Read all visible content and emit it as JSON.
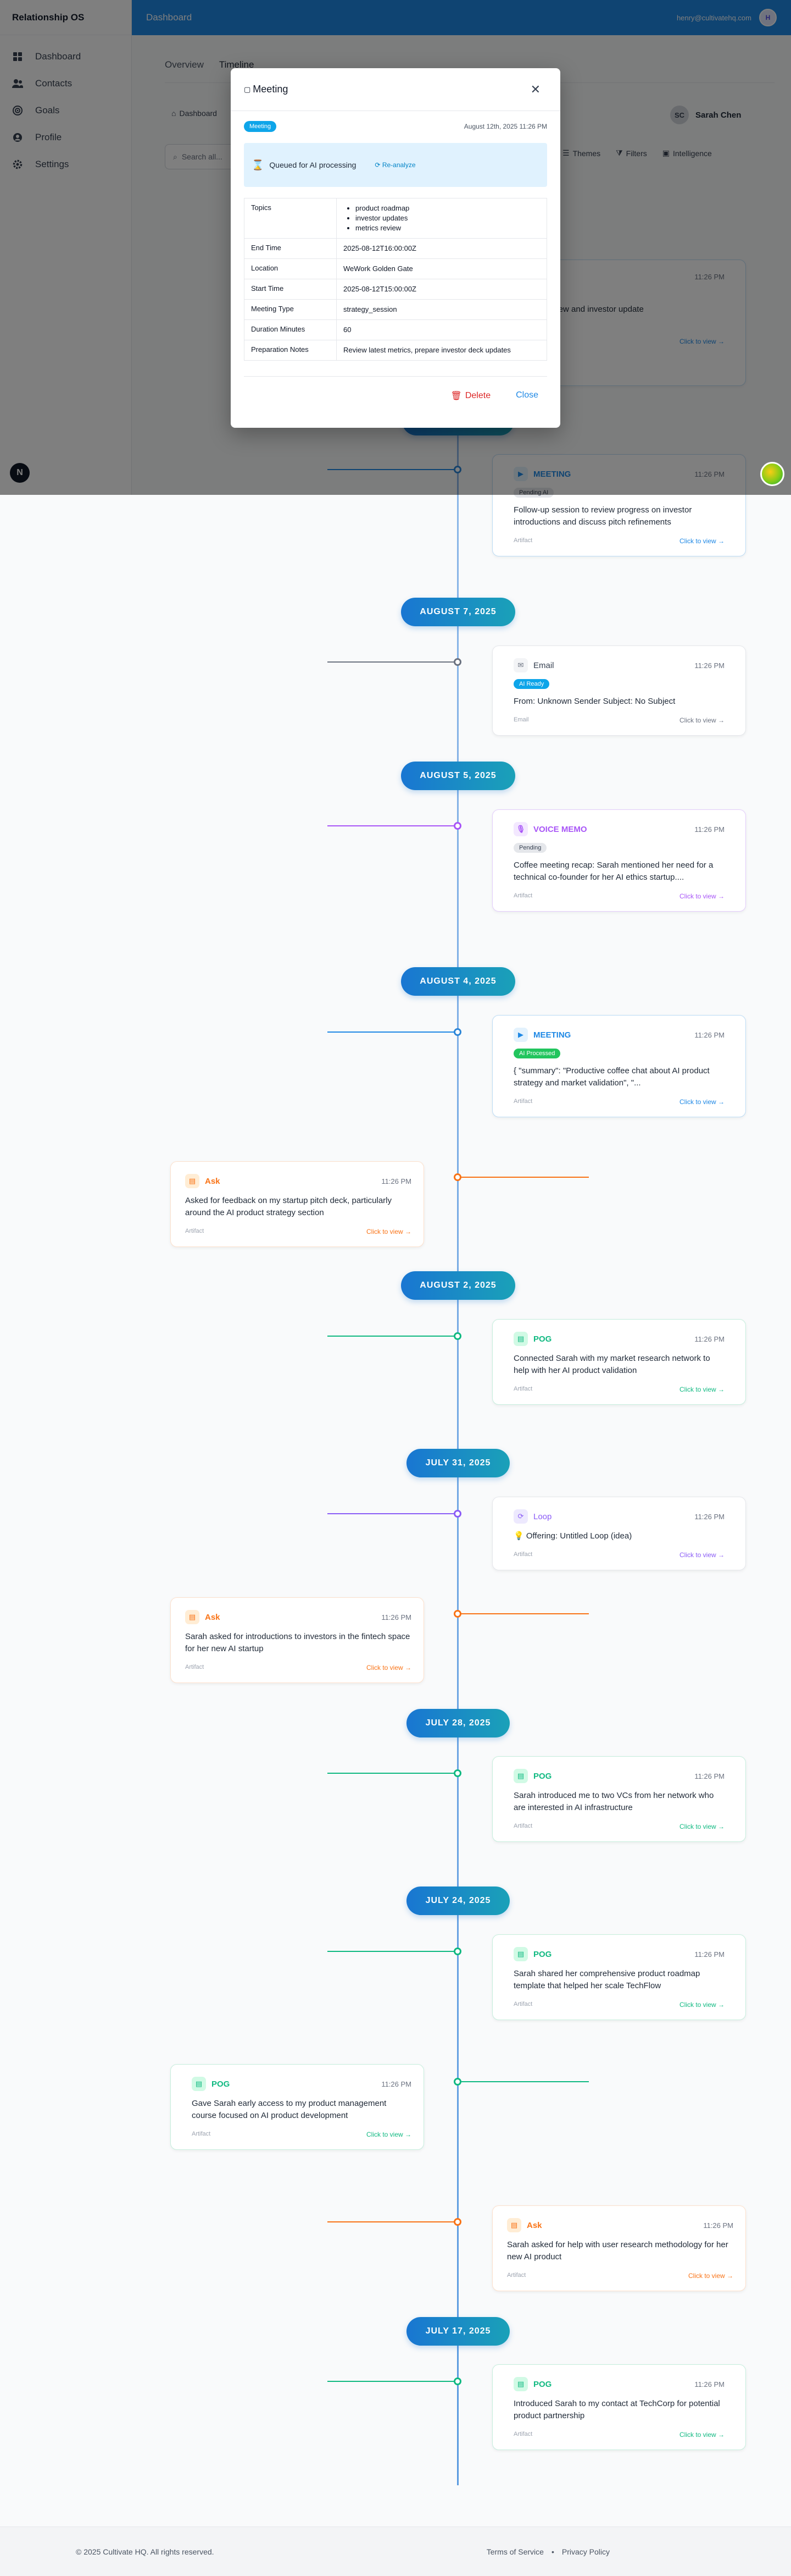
{
  "app": {
    "name": "Relationship OS"
  },
  "topbar": {
    "title": "Dashboard",
    "user_email": "henry@cultivatehq.com"
  },
  "sidebar": {
    "items": [
      {
        "label": "Dashboard",
        "icon": "grid-icon"
      },
      {
        "label": "Contacts",
        "icon": "users-icon"
      },
      {
        "label": "Goals",
        "icon": "target-icon"
      },
      {
        "label": "Profile",
        "icon": "user-icon"
      },
      {
        "label": "Settings",
        "icon": "gear-icon"
      }
    ]
  },
  "fab": {
    "dark_label": "N"
  },
  "main": {
    "tabs": [
      "Overview",
      "Timeline"
    ],
    "breadcrumb": "Dashboard",
    "contact_name": "Sarah Chen",
    "search_placeholder": "Search all...",
    "filters": [
      "Themes",
      "Filters",
      "Intelligence"
    ]
  },
  "modal": {
    "title": "Meeting",
    "chip": "Meeting",
    "date": "August 12th, 2025 11:26 PM",
    "status": "Queued for AI processing",
    "reanalyze": "Re-analyze",
    "fields": [
      {
        "key": "Topics",
        "list": [
          "product roadmap",
          "investor updates",
          "metrics review"
        ]
      },
      {
        "key": "End Time",
        "value": "2025-08-12T16:00:00Z"
      },
      {
        "key": "Location",
        "value": "WeWork Golden Gate"
      },
      {
        "key": "Start Time",
        "value": "2025-08-12T15:00:00Z"
      },
      {
        "key": "Meeting Type",
        "value": "strategy_session"
      },
      {
        "key": "Duration Minutes",
        "value": "60"
      },
      {
        "key": "Preparation Notes",
        "value": "Review latest metrics, prepare investor deck updates"
      }
    ],
    "delete_label": "Delete",
    "close_label": "Close"
  },
  "colors": {
    "meeting": "#1e88e5",
    "email": "#6b7280",
    "voice": "#a855f7",
    "ask": "#f97316",
    "pog": "#10b981",
    "loop": "#8b5cf6"
  },
  "timeline": {
    "hidden_card": {
      "type": "MEETING",
      "time": "11:26 PM",
      "text": "strategy review and investor update",
      "view": "Click to view →"
    },
    "dates": [
      "AUGUST 7, 2025",
      "AUGUST 5, 2025",
      "AUGUST 4, 2025",
      "AUGUST 2, 2025",
      "JULY 31, 2025",
      "JULY 28, 2025",
      "JULY 24, 2025",
      "JULY 17, 2025"
    ],
    "cards": [
      {
        "type": "MEETING",
        "time": "11:26 PM",
        "badge": "Pending AI",
        "text": "Follow-up session to review progress on investor introductions and discuss pitch refinements",
        "label": "Artifact",
        "view": "Click to view →"
      },
      {
        "type": "Email",
        "time": "11:26 PM",
        "badge": "AI Ready",
        "text": "From: Unknown Sender Subject: No Subject",
        "label": "Email",
        "view": "Click to view →"
      },
      {
        "type": "VOICE MEMO",
        "time": "11:26 PM",
        "badge": "Pending",
        "text": "Coffee meeting recap: Sarah mentioned her need for a technical co-founder for her AI ethics startup....",
        "label": "Artifact",
        "view": "Click to view →"
      },
      {
        "type": "MEETING",
        "time": "11:26 PM",
        "badge": "AI Processed",
        "text": "{ \"summary\": \"Productive coffee chat about AI product strategy and market validation\", \"...",
        "label": "Artifact",
        "view": "Click to view →"
      },
      {
        "type": "Ask",
        "time": "11:26 PM",
        "text": "Asked for feedback on my startup pitch deck, particularly around the AI product strategy section",
        "label": "Artifact",
        "view": "Click to view →"
      },
      {
        "type": "POG",
        "time": "11:26 PM",
        "text": "Connected Sarah with my market research network to help with her AI product validation",
        "label": "Artifact",
        "view": "Click to view →"
      },
      {
        "type": "Loop",
        "time": "11:26 PM",
        "text": "Offering: Untitled Loop (idea)",
        "label": "Artifact",
        "view": "Click to view →"
      },
      {
        "type": "Ask",
        "time": "11:26 PM",
        "text": "Sarah asked for introductions to investors in the fintech space for her new AI startup",
        "label": "Artifact",
        "view": "Click to view →"
      },
      {
        "type": "POG",
        "time": "11:26 PM",
        "text": "Sarah introduced me to two VCs from her network who are interested in AI infrastructure",
        "label": "Artifact",
        "view": "Click to view →"
      },
      {
        "type": "POG",
        "time": "11:26 PM",
        "text": "Sarah shared her comprehensive product roadmap template that helped her scale TechFlow",
        "label": "Artifact",
        "view": "Click to view →"
      },
      {
        "type": "POG",
        "time": "11:26 PM",
        "text": "Gave Sarah early access to my product management course focused on AI product development",
        "label": "Artifact",
        "view": "Click to view →"
      },
      {
        "type": "Ask",
        "time": "11:26 PM",
        "text": "Sarah asked for help with user research methodology for her new AI product",
        "label": "Artifact",
        "view": "Click to view →"
      },
      {
        "type": "POG",
        "time": "11:26 PM",
        "text": "Introduced Sarah to my contact at TechCorp for potential product partnership",
        "label": "Artifact",
        "view": "Click to view →"
      }
    ]
  },
  "footer": {
    "copyright": "© 2025 Cultivate HQ. All rights reserved.",
    "terms": "Terms of Service",
    "sep": "•",
    "privacy": "Privacy Policy"
  }
}
